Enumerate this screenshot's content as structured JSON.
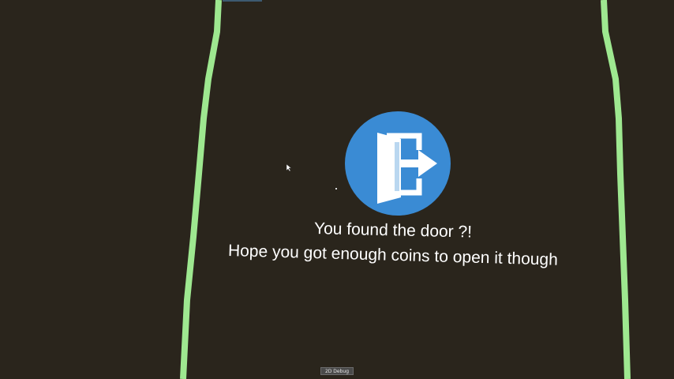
{
  "messages": {
    "line1": "You found the door ?!",
    "line2": "Hope you got enough coins to open it though"
  },
  "door_icon": {
    "icon": "exit-door-icon",
    "circle_color": "#3a8bd4",
    "glyph_color": "#ffffff"
  },
  "debug": {
    "label": "2D Debug"
  },
  "colors": {
    "background": "#2a251c",
    "wall": "#9ee890"
  }
}
